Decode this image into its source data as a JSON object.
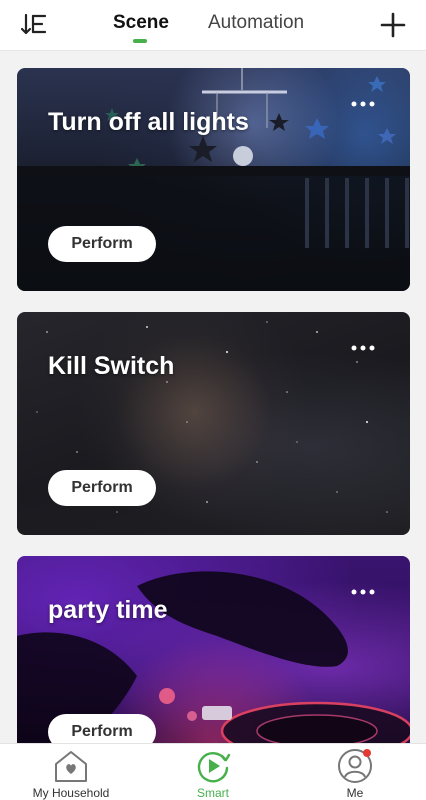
{
  "colors": {
    "accent": "#47b04b",
    "badge": "#e53935"
  },
  "header": {
    "tabs": [
      {
        "label": "Scene",
        "active": true
      },
      {
        "label": "Automation",
        "active": false
      }
    ],
    "sort_icon": "sort-list-icon",
    "add_icon": "plus-icon"
  },
  "scenes": [
    {
      "title": "Turn off all lights",
      "action_label": "Perform",
      "more_icon": "more-horizontal-icon"
    },
    {
      "title": "Kill Switch",
      "action_label": "Perform",
      "more_icon": "more-horizontal-icon"
    },
    {
      "title": "party time",
      "action_label": "Perform",
      "more_icon": "more-horizontal-icon"
    }
  ],
  "bottom_nav": {
    "items": [
      {
        "label": "My Household",
        "icon": "house-heart-icon",
        "active": false
      },
      {
        "label": "Smart",
        "icon": "smart-play-icon",
        "active": true
      },
      {
        "label": "Me",
        "icon": "user-circle-icon",
        "active": false,
        "has_badge": true
      }
    ]
  }
}
